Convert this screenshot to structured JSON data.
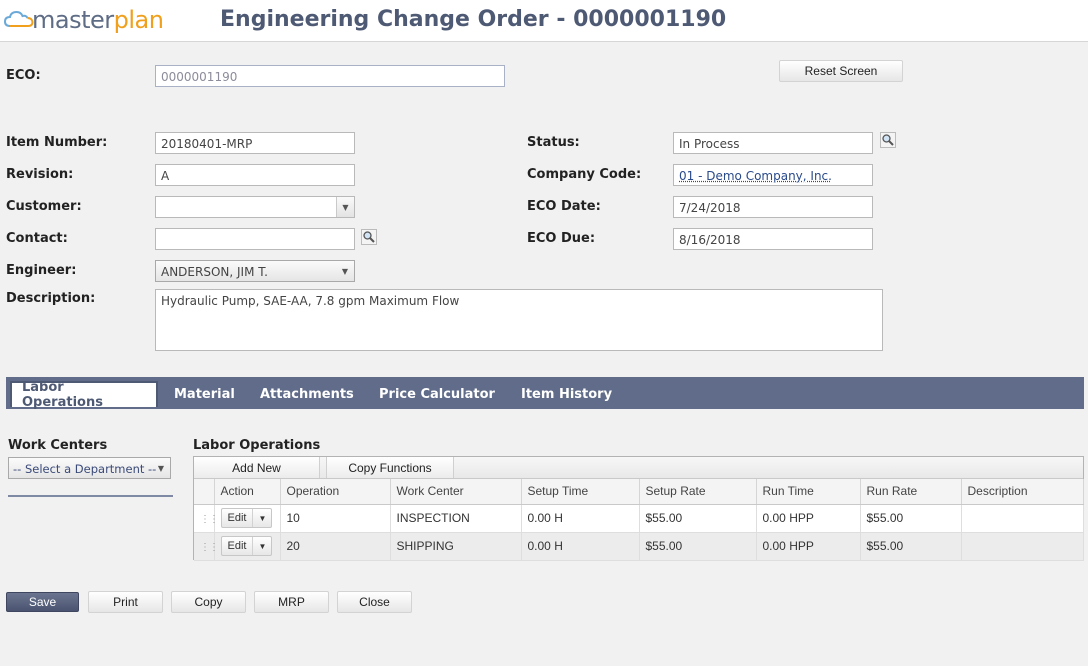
{
  "app": {
    "logo_main": "masterplan"
  },
  "header": {
    "title": "Engineering Change Order - 0000001190"
  },
  "form": {
    "eco_label": "ECO:",
    "eco_value": "0000001190",
    "reset_label": "Reset Screen",
    "item_number_label": "Item Number:",
    "item_number_value": "20180401-MRP",
    "revision_label": "Revision:",
    "revision_value": "A",
    "customer_label": "Customer:",
    "customer_value": "",
    "contact_label": "Contact:",
    "contact_value": "",
    "engineer_label": "Engineer:",
    "engineer_value": "ANDERSON, JIM T.",
    "description_label": "Description:",
    "description_value": "Hydraulic Pump, SAE-AA, 7.8 gpm Maximum Flow",
    "status_label": "Status:",
    "status_value": "In Process",
    "company_code_label": "Company Code:",
    "company_code_value": "01 - Demo Company, Inc.",
    "eco_date_label": "ECO Date:",
    "eco_date_value": "7/24/2018",
    "eco_due_label": "ECO Due:",
    "eco_due_value": "8/16/2018"
  },
  "tabs": [
    {
      "label": "Labor Operations",
      "active": true
    },
    {
      "label": "Material"
    },
    {
      "label": "Attachments"
    },
    {
      "label": "Price Calculator"
    },
    {
      "label": "Item History"
    }
  ],
  "work_centers": {
    "title": "Work Centers",
    "department_placeholder": "-- Select a Department --"
  },
  "labor_ops": {
    "title": "Labor Operations",
    "add_new": "Add New",
    "copy_functions": "Copy Functions",
    "columns": [
      "Action",
      "Operation",
      "Work Center",
      "Setup Time",
      "Setup Rate",
      "Run Time",
      "Run Rate",
      "Description"
    ],
    "edit_label": "Edit",
    "rows": [
      {
        "operation": "10",
        "work_center": "INSPECTION",
        "setup_time": "0.00 H",
        "setup_rate": "$55.00",
        "run_time": "0.00 HPP",
        "run_rate": "$55.00",
        "description": ""
      },
      {
        "operation": "20",
        "work_center": "SHIPPING",
        "setup_time": "0.00 H",
        "setup_rate": "$55.00",
        "run_time": "0.00 HPP",
        "run_rate": "$55.00",
        "description": ""
      }
    ]
  },
  "footer": {
    "save": "Save",
    "print": "Print",
    "copy": "Copy",
    "mrp": "MRP",
    "close": "Close"
  },
  "colors": {
    "accent": "#606c89",
    "title": "#4e5a74",
    "logo_plan": "#f0a01c"
  }
}
